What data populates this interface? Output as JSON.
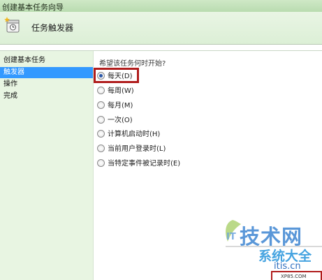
{
  "window": {
    "title": "创建基本任务向导"
  },
  "header": {
    "title": "任务触发器",
    "icon": "task-wizard-icon"
  },
  "sidebar": {
    "items": [
      {
        "label": "创建基本任务",
        "active": false
      },
      {
        "label": "触发器",
        "active": true
      },
      {
        "label": "操作",
        "active": false
      },
      {
        "label": "完成",
        "active": false
      }
    ]
  },
  "main": {
    "question": "希望该任务何时开始?",
    "options": [
      {
        "label": "每天(D)",
        "selected": true
      },
      {
        "label": "每周(W)",
        "selected": false
      },
      {
        "label": "每月(M)",
        "selected": false
      },
      {
        "label": "一次(O)",
        "selected": false
      },
      {
        "label": "计算机启动时(H)",
        "selected": false
      },
      {
        "label": "当前用户登录时(L)",
        "selected": false
      },
      {
        "label": "当特定事件被记录时(E)",
        "selected": false
      }
    ]
  },
  "watermark": {
    "brand": "技术网",
    "brand2": "系统大全",
    "url": "itis.cn",
    "url2": "XP85.COM"
  },
  "colors": {
    "highlight": "#b01c1c",
    "selection": "#3399ff",
    "sidebar_bg": "#e8f5e2"
  }
}
